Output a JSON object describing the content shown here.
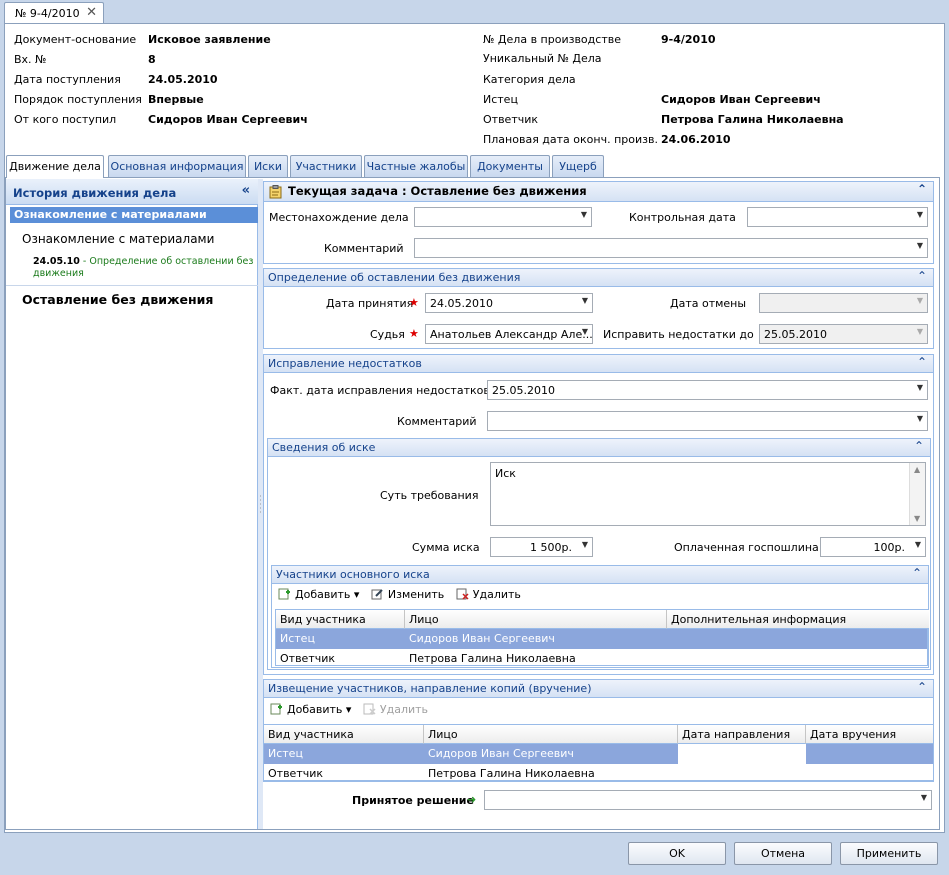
{
  "doc_tab": {
    "title": "№ 9-4/2010",
    "close": "✕"
  },
  "header": {
    "left": [
      {
        "label": "Документ-основание",
        "value": "Исковое заявление"
      },
      {
        "label": "Вх. №",
        "value": "8"
      },
      {
        "label": "Дата поступления",
        "value": "24.05.2010"
      },
      {
        "label": "Порядок поступления",
        "value": "Впервые"
      },
      {
        "label": "От кого поступил",
        "value": "Сидоров Иван Сергеевич"
      }
    ],
    "right": [
      {
        "label": "№ Дела в производстве",
        "value": "9-4/2010"
      },
      {
        "label": "Уникальный № Дела",
        "value": ""
      },
      {
        "label": "Категория дела",
        "value": ""
      },
      {
        "label": "Истец",
        "value": "Сидоров Иван Сергеевич"
      },
      {
        "label": "Ответчик",
        "value": "Петрова Галина Николаевна"
      },
      {
        "label": "Плановая дата оконч. произв.",
        "value": "24.06.2010"
      }
    ]
  },
  "tabs": [
    "Движение дела",
    "Основная информация",
    "Иски",
    "Участники",
    "Частные жалобы",
    "Документы",
    "Ущерб"
  ],
  "history": {
    "title": "История движения дела",
    "collapse": "«",
    "selected": "Ознакомление с материалами",
    "item": "Ознакомление с материалами",
    "sub_date": "24.05.10",
    "sub_sep": " - ",
    "sub_text": "Определение об оставлении без движения",
    "main": "Оставление без движения"
  },
  "task": {
    "title": "Текущая задача : Оставление без движения",
    "location_label": "Местонахождение дела",
    "location_value": "",
    "control_date_label": "Контрольная дата",
    "control_date_value": "",
    "comment_label": "Комментарий",
    "comment_value": ""
  },
  "decision": {
    "title": "Определение об оставлении без движения",
    "date_label": "Дата принятия",
    "date_value": "24.05.2010",
    "cancel_label": "Дата отмены",
    "cancel_value": "",
    "judge_label": "Судья",
    "judge_value": "Анатольев Александр Але...",
    "fix_until_label": "Исправить недостатки до",
    "fix_until_value": "25.05.2010",
    "required_mark": "★"
  },
  "fix": {
    "title": "Исправление недостатков",
    "fact_label": "Факт. дата исправления недостатков",
    "fact_value": "25.05.2010",
    "comment_label": "Комментарий",
    "comment_value": ""
  },
  "claim": {
    "title": "Сведения об иске",
    "essence_label": "Суть требования",
    "essence_value": "Иск",
    "sum_label": "Сумма иска",
    "sum_value": "1 500р.",
    "duty_label": "Оплаченная госпошлина",
    "duty_value": "100р."
  },
  "claim_participants": {
    "title": "Участники основного иска",
    "add": "Добавить",
    "edit": "Изменить",
    "delete": "Удалить",
    "columns": [
      "Вид участника",
      "Лицо",
      "Дополнительная информация"
    ],
    "rows": [
      {
        "kind": "Истец",
        "person": "Сидоров Иван Сергеевич",
        "info": ""
      },
      {
        "kind": "Ответчик",
        "person": "Петрова Галина Николаевна",
        "info": ""
      }
    ]
  },
  "notice": {
    "title": "Извещение участников, направление копий (вручение)",
    "add": "Добавить",
    "delete": "Удалить",
    "columns": [
      "Вид участника",
      "Лицо",
      "Дата направления",
      "Дата вручения"
    ],
    "rows": [
      {
        "kind": "Истец",
        "person": "Сидоров Иван Сергеевич",
        "sent": "",
        "delivered": ""
      },
      {
        "kind": "Ответчик",
        "person": "Петрова Галина Николаевна",
        "sent": "",
        "delivered": ""
      }
    ]
  },
  "result": {
    "label": "Принятое решение",
    "value": ""
  },
  "buttons": {
    "ok": "OK",
    "cancel": "Отмена",
    "apply": "Применить"
  },
  "glyphs": {
    "dropdown": "▼",
    "collapse": "⌃",
    "arrow": "➜",
    "menu_arrow": "▾"
  }
}
